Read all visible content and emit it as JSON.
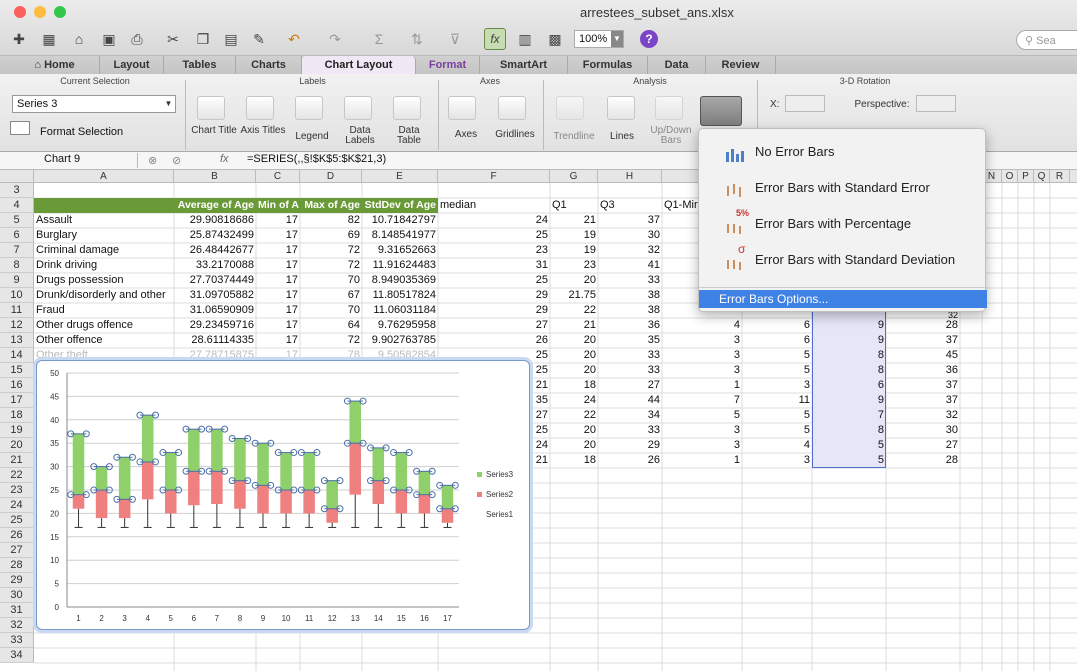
{
  "window": {
    "title": "arrestees_subset_ans.xlsx",
    "zoom": "100%",
    "search_placeholder": "Sea"
  },
  "tabs": [
    "Home",
    "Layout",
    "Tables",
    "Charts",
    "Chart Layout",
    "Format",
    "SmartArt",
    "Formulas",
    "Data",
    "Review"
  ],
  "ribbon": {
    "groups": {
      "current_selection": "Current Selection",
      "labels": "Labels",
      "axes": "Axes",
      "analysis": "Analysis",
      "rotation": "3-D Rotation"
    },
    "selection_value": "Series 3",
    "format_selection": "Format Selection",
    "buttons": {
      "chart_title": "Chart Title",
      "axis_titles": "Axis Titles",
      "legend": "Legend",
      "data_labels": "Data Labels",
      "data_table": "Data Table",
      "axes": "Axes",
      "gridlines": "Gridlines",
      "trendline": "Trendline",
      "lines": "Lines",
      "updown_bars": "Up/Down Bars"
    },
    "x_label": "X:",
    "perspective_label": "Perspective:"
  },
  "formula_bar": {
    "name_box": "Chart 9",
    "formula": "=SERIES(,,§!$K$5:$K$21,3)"
  },
  "columns": [
    "A",
    "B",
    "C",
    "D",
    "E",
    "F",
    "G",
    "H",
    "I",
    "J",
    "K",
    "L",
    "M",
    "N",
    "O",
    "P",
    "Q",
    "R"
  ],
  "header_row": {
    "B": "Average of Age",
    "C": "Min of A",
    "D": "Max of Age",
    "E": "StdDev of Age",
    "F": "median",
    "G": "Q1",
    "H": "Q3",
    "I": "Q1-Min"
  },
  "rows": [
    {
      "n": "5",
      "a": "Assault",
      "b": "29.90818686",
      "c": "17",
      "d": "82",
      "e": "10.71842797",
      "f": "24",
      "g": "21",
      "h": "37"
    },
    {
      "n": "6",
      "a": "Burglary",
      "b": "25.87432499",
      "c": "17",
      "d": "69",
      "e": "8.148541977",
      "f": "25",
      "g": "19",
      "h": "30"
    },
    {
      "n": "7",
      "a": "Criminal damage",
      "b": "26.48442677",
      "c": "17",
      "d": "72",
      "e": "9.31652663",
      "f": "23",
      "g": "19",
      "h": "32"
    },
    {
      "n": "8",
      "a": "Drink driving",
      "b": "33.2170088",
      "c": "17",
      "d": "72",
      "e": "11.91624483",
      "f": "31",
      "g": "23",
      "h": "41"
    },
    {
      "n": "9",
      "a": "Drugs possession",
      "b": "27.70374449",
      "c": "17",
      "d": "70",
      "e": "8.949035369",
      "f": "25",
      "g": "20",
      "h": "33"
    },
    {
      "n": "10",
      "a": "Drunk/disorderly and other",
      "b": "31.09705882",
      "c": "17",
      "d": "67",
      "e": "11.80517824",
      "f": "29",
      "g": "21.75",
      "h": "38"
    },
    {
      "n": "11",
      "a": "Fraud",
      "b": "31.06590909",
      "c": "17",
      "d": "70",
      "e": "11.06031184",
      "f": "29",
      "g": "22",
      "h": "38"
    },
    {
      "n": "12",
      "a": "Other drugs offence",
      "b": "29.23459716",
      "c": "17",
      "d": "64",
      "e": "9.76295958",
      "f": "27",
      "g": "21",
      "h": "36",
      "i": "4",
      "j": "6",
      "k": "9",
      "l": "28"
    },
    {
      "n": "13",
      "a": "Other offence",
      "b": "28.61114335",
      "c": "17",
      "d": "72",
      "e": "9.902763785",
      "f": "26",
      "g": "20",
      "h": "35",
      "i": "3",
      "j": "6",
      "k": "9",
      "l": "37"
    },
    {
      "n": "14",
      "a": "Other theft",
      "b": "27.78715875",
      "c": "17",
      "d": "78",
      "e": "9.50582854",
      "f": "25",
      "g": "20",
      "h": "33",
      "i": "3",
      "j": "5",
      "k": "8",
      "l": "45"
    },
    {
      "n": "15",
      "f": "25",
      "g": "20",
      "h": "33",
      "i": "3",
      "j": "5",
      "k": "8",
      "l": "36"
    },
    {
      "n": "16",
      "f": "21",
      "g": "18",
      "h": "27",
      "i": "1",
      "j": "3",
      "k": "6",
      "l": "37"
    },
    {
      "n": "17",
      "f": "35",
      "g": "24",
      "h": "44",
      "i": "7",
      "j": "11",
      "k": "9",
      "l": "37"
    },
    {
      "n": "18",
      "f": "27",
      "g": "22",
      "h": "34",
      "i": "5",
      "j": "5",
      "k": "7",
      "l": "32"
    },
    {
      "n": "19",
      "f": "25",
      "g": "20",
      "h": "33",
      "i": "3",
      "j": "5",
      "k": "8",
      "l": "30"
    },
    {
      "n": "20",
      "f": "24",
      "g": "20",
      "h": "29",
      "i": "3",
      "j": "4",
      "k": "5",
      "l": "27"
    },
    {
      "n": "21",
      "f": "21",
      "g": "18",
      "h": "26",
      "i": "1",
      "j": "3",
      "k": "5",
      "l": "28"
    }
  ],
  "partial_row_11_l": "32",
  "extra_row_numbers": [
    "3",
    "4",
    "22",
    "23",
    "24",
    "25",
    "26",
    "27",
    "28",
    "29",
    "30",
    "31",
    "32",
    "33",
    "34"
  ],
  "error_menu": {
    "items": [
      "No Error Bars",
      "Error Bars with Standard Error",
      "Error Bars with Percentage",
      "Error Bars with Standard Deviation"
    ],
    "options": "Error Bars Options...",
    "percent_badge": "5%",
    "sigma_badge": "σ"
  },
  "chart_data": {
    "type": "bar",
    "stacked": true,
    "categories": [
      "1",
      "2",
      "3",
      "4",
      "5",
      "6",
      "7",
      "8",
      "9",
      "10",
      "11",
      "12",
      "13",
      "14",
      "15",
      "16",
      "17"
    ],
    "series": [
      {
        "name": "Series1",
        "values": [
          21,
          19,
          19,
          23,
          20,
          21.75,
          22,
          21,
          20,
          20,
          20,
          18,
          24,
          22,
          20,
          20,
          18
        ],
        "color": "none"
      },
      {
        "name": "Series2",
        "values": [
          3,
          6,
          4,
          8,
          5,
          7.25,
          7,
          6,
          6,
          5,
          5,
          3,
          11,
          5,
          5,
          4,
          3
        ],
        "color": "#f08080"
      },
      {
        "name": "Series3",
        "values": [
          13,
          5,
          9,
          10,
          8,
          9,
          9,
          9,
          9,
          8,
          8,
          6,
          9,
          7,
          8,
          5,
          5
        ],
        "color": "#8fd06a"
      }
    ],
    "whisker_low": [
      17,
      17,
      17,
      17,
      17,
      17,
      17,
      17,
      17,
      17,
      17,
      17,
      17,
      17,
      17,
      17,
      17
    ],
    "ylim": [
      0,
      50
    ],
    "yticks": [
      "0",
      "5",
      "10",
      "15",
      "20",
      "25",
      "30",
      "35",
      "40",
      "45",
      "50"
    ],
    "legend_position": "right",
    "grid": true
  }
}
